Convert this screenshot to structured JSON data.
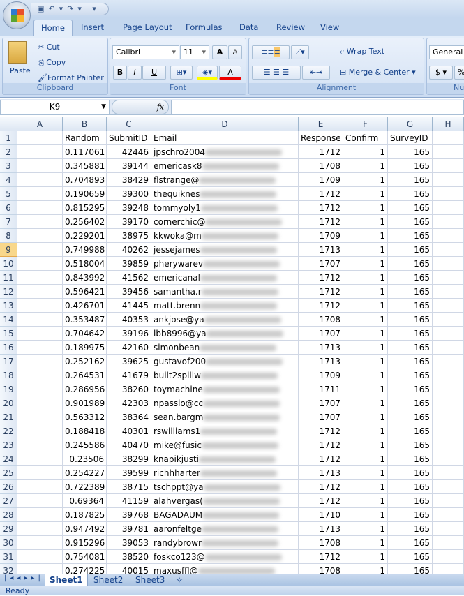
{
  "ribbon": {
    "tabs": [
      "Home",
      "Insert",
      "Page Layout",
      "Formulas",
      "Data",
      "Review",
      "View"
    ],
    "active_tab": "Home",
    "clipboard": {
      "label": "Clipboard",
      "paste": "Paste",
      "cut": "Cut",
      "copy": "Copy",
      "format_painter": "Format Painter"
    },
    "font": {
      "label": "Font",
      "name": "Calibri",
      "size": "11",
      "bold": "B",
      "italic": "I",
      "underline": "U",
      "grow": "A",
      "shrink": "A",
      "font_color": "A"
    },
    "alignment": {
      "label": "Alignment",
      "wrap_text": "Wrap Text",
      "merge_center": "Merge & Center"
    },
    "number": {
      "label": "Nur",
      "format": "General",
      "currency": "$",
      "percent": "%"
    }
  },
  "formula_bar": {
    "name_box": "K9",
    "fx": "fx",
    "formula": ""
  },
  "columns": [
    "A",
    "B",
    "C",
    "D",
    "E",
    "F",
    "G",
    "H"
  ],
  "headers": [
    "",
    "Random",
    "SubmitID",
    "Email",
    "Response",
    "Confirm",
    "SurveyID",
    ""
  ],
  "selected_row": 9,
  "rows": [
    [
      "0.117061",
      "42446",
      "jpschro2004",
      "1712",
      "1",
      "165"
    ],
    [
      "0.345881",
      "39144",
      "emericask8",
      "1708",
      "1",
      "165"
    ],
    [
      "0.704893",
      "38429",
      "flstrange@",
      "1709",
      "1",
      "165"
    ],
    [
      "0.190659",
      "39300",
      "thequiknes",
      "1712",
      "1",
      "165"
    ],
    [
      "0.815295",
      "39248",
      "tommyoly1",
      "1712",
      "1",
      "165"
    ],
    [
      "0.256402",
      "39170",
      "cornerchic@",
      "1712",
      "1",
      "165"
    ],
    [
      "0.229201",
      "38975",
      "kkwoka@m",
      "1709",
      "1",
      "165"
    ],
    [
      "0.749988",
      "40262",
      "jessejames",
      "1713",
      "1",
      "165"
    ],
    [
      "0.518004",
      "39859",
      "pherywarev",
      "1707",
      "1",
      "165"
    ],
    [
      "0.843992",
      "41562",
      "emericanal",
      "1712",
      "1",
      "165"
    ],
    [
      "0.596421",
      "39456",
      "samantha.r",
      "1712",
      "1",
      "165"
    ],
    [
      "0.426701",
      "41445",
      "matt.brenn",
      "1712",
      "1",
      "165"
    ],
    [
      "0.353487",
      "40353",
      "ankjose@ya",
      "1708",
      "1",
      "165"
    ],
    [
      "0.704642",
      "39196",
      "lbb8996@ya",
      "1707",
      "1",
      "165"
    ],
    [
      "0.189975",
      "42160",
      "simonbean",
      "1713",
      "1",
      "165"
    ],
    [
      "0.252162",
      "39625",
      "gustavof200",
      "1713",
      "1",
      "165"
    ],
    [
      "0.264531",
      "41679",
      "built2spillw",
      "1709",
      "1",
      "165"
    ],
    [
      "0.286956",
      "38260",
      "toymachine",
      "1711",
      "1",
      "165"
    ],
    [
      "0.901989",
      "42303",
      "npassio@cc",
      "1707",
      "1",
      "165"
    ],
    [
      "0.563312",
      "38364",
      "sean.bargm",
      "1707",
      "1",
      "165"
    ],
    [
      "0.188418",
      "40301",
      "rswilliams1",
      "1712",
      "1",
      "165"
    ],
    [
      "0.245586",
      "40470",
      "mike@fusic",
      "1712",
      "1",
      "165"
    ],
    [
      "0.23506",
      "38299",
      "knapikjusti",
      "1712",
      "1",
      "165"
    ],
    [
      "0.254227",
      "39599",
      "richhharter",
      "1713",
      "1",
      "165"
    ],
    [
      "0.722389",
      "38715",
      "tschppt@ya",
      "1712",
      "1",
      "165"
    ],
    [
      "0.69364",
      "41159",
      "alahvergas(",
      "1712",
      "1",
      "165"
    ],
    [
      "0.187825",
      "39768",
      "BAGADAUM",
      "1710",
      "1",
      "165"
    ],
    [
      "0.947492",
      "39781",
      "aaronfeltge",
      "1713",
      "1",
      "165"
    ],
    [
      "0.915296",
      "39053",
      "randybrowr",
      "1708",
      "1",
      "165"
    ],
    [
      "0.754081",
      "38520",
      "foskco123@",
      "1712",
      "1",
      "165"
    ],
    [
      "0.274225",
      "40015",
      "maxusffl@",
      "1708",
      "1",
      "165"
    ]
  ],
  "sheets": [
    "Sheet1",
    "Sheet2",
    "Sheet3"
  ],
  "active_sheet": "Sheet1",
  "status": "Ready"
}
